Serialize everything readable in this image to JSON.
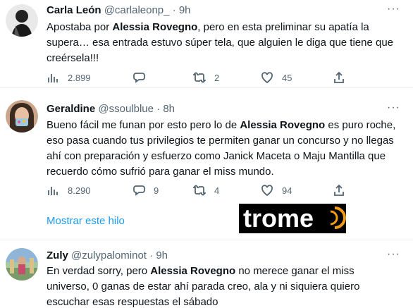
{
  "tweets": [
    {
      "name": "Carla León",
      "handle": "@carlaleonp_",
      "dot": "·",
      "time": "9h",
      "text_before": "Apostaba por ",
      "text_bold": "Alessia Rovegno",
      "text_after": ", pero en esta preliminar su apatía la supera… esa entrada estuvo súper tela, que alguien le diga que tiene que creérsela!!!",
      "views": "2.899",
      "replies": "",
      "retweets": "2",
      "likes": "45"
    },
    {
      "name": "Geraldine",
      "handle": "@ssoulblue",
      "dot": "·",
      "time": "8h",
      "text_before": "Bueno fácil me funan por esto pero lo de ",
      "text_bold": "Alessia Rovegno",
      "text_after": " es puro roche, eso pasa cuando tus privilegios te permiten ganar un concurso y no llegas ahí con preparación y esfuerzo como Janick Maceta o Maju Mantilla que recuerdo cómo sufrió para ganar el miss mundo.",
      "views": "8.290",
      "replies": "9",
      "retweets": "4",
      "likes": "94"
    },
    {
      "name": "Zuly",
      "handle": "@zulypalominot",
      "dot": "·",
      "time": "9h",
      "text_before": "En verdad sorry, pero ",
      "text_bold": "Alessia Rovegno",
      "text_after": " no merece ganar el miss universo, 0 ganas de estar ahí parada creo, ala y ni siquiera quiero escuchar esas respuestas el sábado"
    }
  ],
  "show_thread": "Mostrar este hilo",
  "watermark": "trome",
  "colors": {
    "accent": "#1d9bf0",
    "secondary_text": "#536471",
    "watermark_orange": "#f39c12"
  }
}
